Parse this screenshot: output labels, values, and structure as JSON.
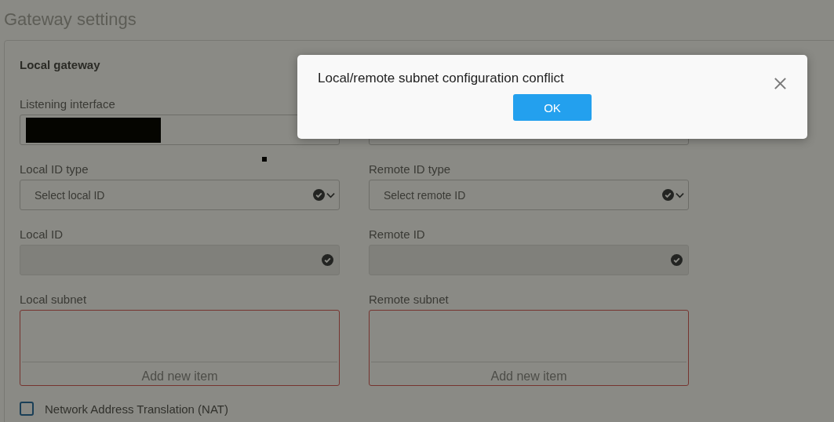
{
  "page": {
    "title": "Gateway settings"
  },
  "section": {
    "title": "Local gateway"
  },
  "columns": [
    {
      "fields": [
        {
          "kind": "redacted",
          "label": "Listening interface"
        },
        {
          "kind": "select",
          "label": "Local ID type",
          "placeholder": "Select local ID",
          "disabled": false,
          "invalid": false
        },
        {
          "kind": "input",
          "label": "Local ID",
          "disabled": true,
          "invalid": false
        },
        {
          "kind": "list",
          "label": "Local subnet",
          "action": "Add new item",
          "disabled": false,
          "invalid": true
        }
      ]
    },
    {
      "fields": [
        {
          "kind": "text"
        },
        {
          "kind": "select",
          "label": "Remote ID type",
          "placeholder": "Select remote ID",
          "disabled": false,
          "invalid": false
        },
        {
          "kind": "input",
          "label": "Remote ID",
          "disabled": true,
          "invalid": false
        },
        {
          "kind": "list",
          "label": "Remote subnet",
          "action": "Add new item",
          "disabled": false,
          "invalid": true
        }
      ]
    }
  ],
  "nat": {
    "label": "Network Address Translation (NAT)",
    "checked": false
  },
  "dialog": {
    "message": "Local/remote subnet configuration conflict",
    "button": "OK"
  }
}
